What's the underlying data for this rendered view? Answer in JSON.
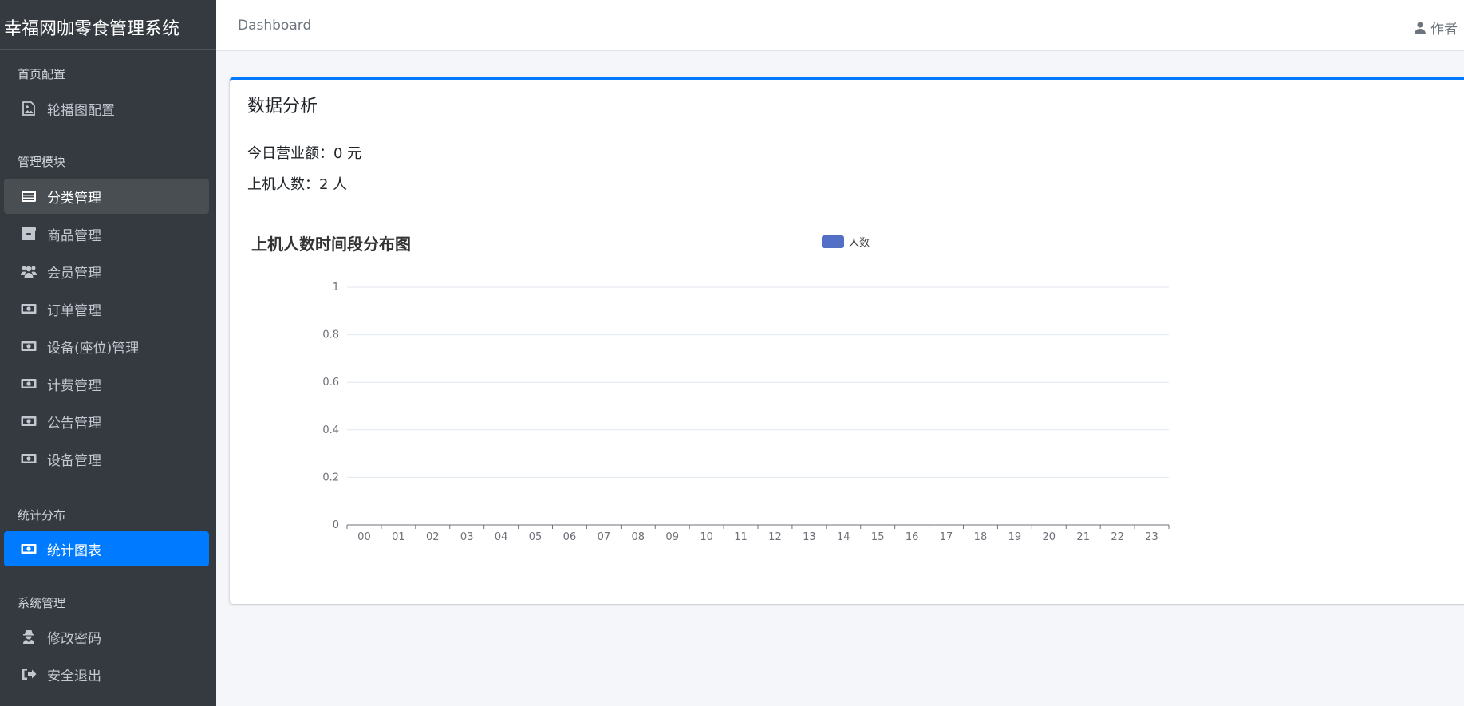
{
  "sidebar": {
    "brand": "幸福网咖零食管理系统",
    "sections": [
      {
        "header": "首页配置",
        "items": [
          {
            "label": "轮播图配置",
            "icon": "image-icon"
          }
        ]
      },
      {
        "header": "管理模块",
        "items": [
          {
            "label": "分类管理",
            "icon": "list-icon"
          },
          {
            "label": "商品管理",
            "icon": "archive-icon"
          },
          {
            "label": "会员管理",
            "icon": "users-icon"
          },
          {
            "label": "订单管理",
            "icon": "money-bill-icon"
          },
          {
            "label": "设备(座位)管理",
            "icon": "money-bill-icon"
          },
          {
            "label": "计费管理",
            "icon": "money-bill-icon"
          },
          {
            "label": "公告管理",
            "icon": "money-bill-icon"
          },
          {
            "label": "设备管理",
            "icon": "money-bill-icon"
          }
        ]
      },
      {
        "header": "统计分布",
        "items": [
          {
            "label": "统计图表",
            "icon": "money-bill-icon"
          }
        ]
      },
      {
        "header": "系统管理",
        "items": [
          {
            "label": "修改密码",
            "icon": "user-secret-icon"
          },
          {
            "label": "安全退出",
            "icon": "sign-out-icon"
          }
        ]
      }
    ]
  },
  "topbar": {
    "breadcrumb": "Dashboard",
    "user": "作者"
  },
  "card": {
    "title": "数据分析",
    "revenue": "今日营业额：0 元",
    "users_online": "上机人数：2 人"
  },
  "colors": {
    "accent": "#007bff",
    "sidebar_bg": "#343a40",
    "series": "#5470c6"
  },
  "chart_data": {
    "type": "bar",
    "title": "上机人数时间段分布图",
    "legend_position": "top-center",
    "grid": true,
    "categories": [
      "00",
      "01",
      "02",
      "03",
      "04",
      "05",
      "06",
      "07",
      "08",
      "09",
      "10",
      "11",
      "12",
      "13",
      "14",
      "15",
      "16",
      "17",
      "18",
      "19",
      "20",
      "21",
      "22",
      "23"
    ],
    "series": [
      {
        "name": "人数",
        "values": [
          0,
          0,
          0,
          0,
          0,
          0,
          0,
          0,
          0,
          0,
          0,
          0,
          0,
          0,
          0,
          0,
          0,
          0,
          0,
          0,
          0,
          0,
          0,
          0
        ]
      }
    ],
    "ylim": [
      0,
      1
    ],
    "yticks": [
      "0",
      "0.2",
      "0.4",
      "0.6",
      "0.8",
      "1"
    ]
  }
}
